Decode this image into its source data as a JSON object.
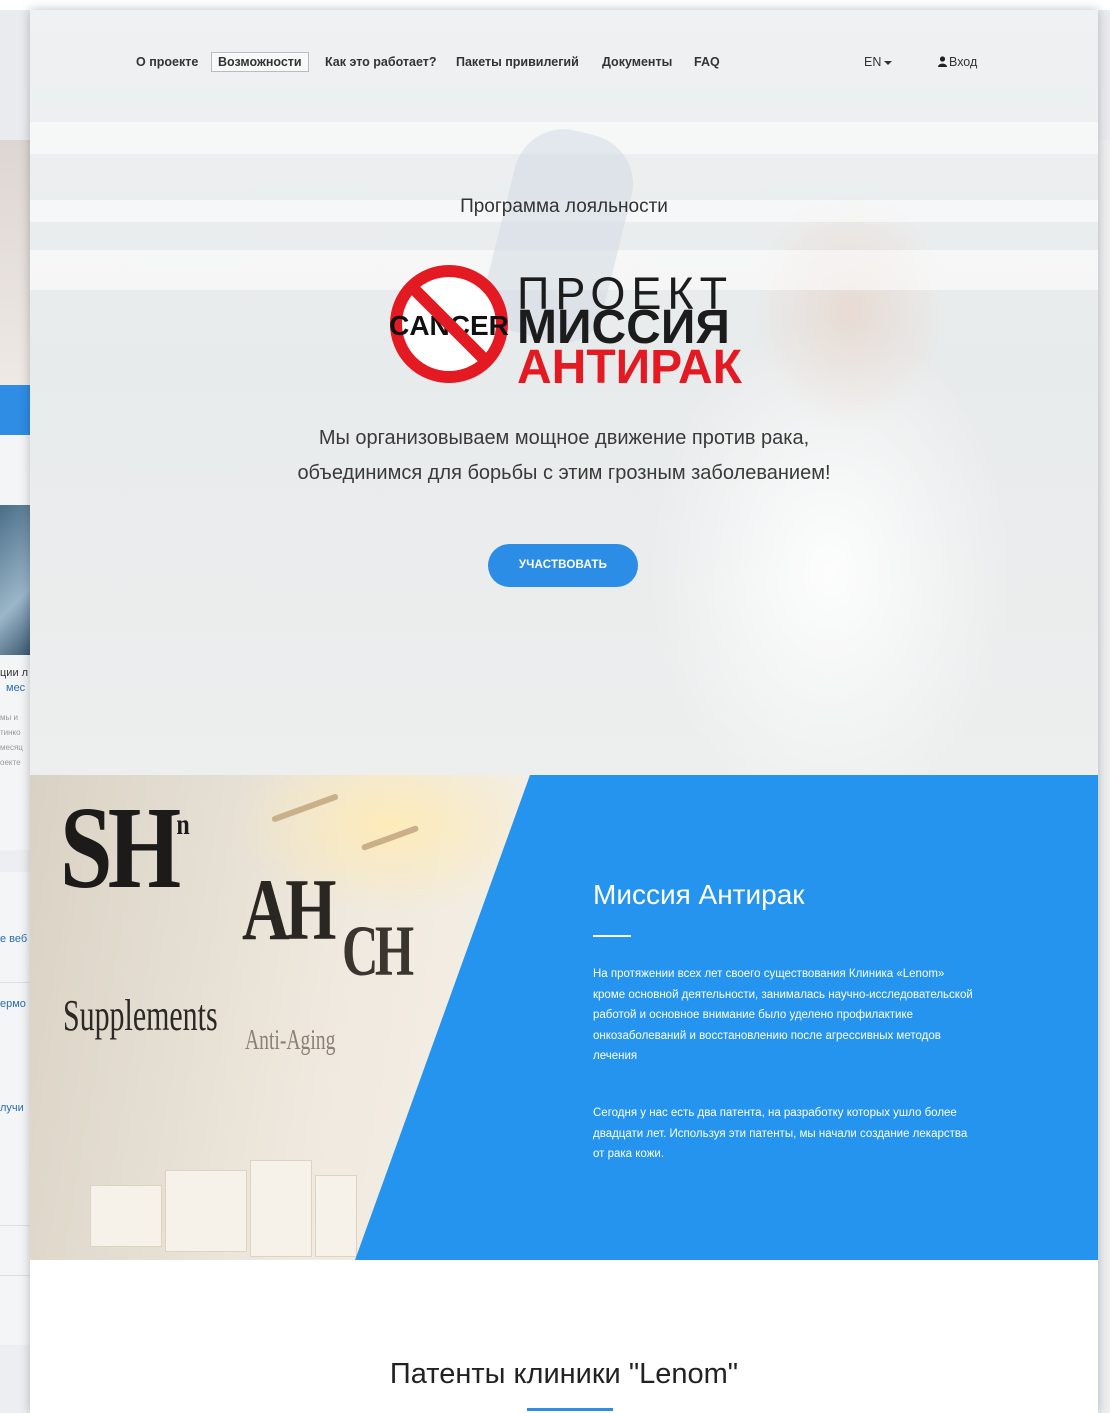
{
  "nav": {
    "items": [
      {
        "label": "О проекте",
        "active": false
      },
      {
        "label": "Возможности",
        "active": true
      },
      {
        "label": "Как это работает?",
        "active": false
      },
      {
        "label": "Пакеты привилегий",
        "active": false
      },
      {
        "label": "Документы",
        "active": false
      },
      {
        "label": "FAQ",
        "active": false
      }
    ],
    "language": "EN",
    "login": "Вход"
  },
  "hero": {
    "subtitle": "Программа лояльности",
    "logo": {
      "badge_text": "CANCER",
      "line1": "ПРОЕКТ",
      "line2": "МИССИЯ",
      "line3": "АНТИРАК"
    },
    "text_line1": "Мы организовываем мощное движение против рака,",
    "text_line2": "объединимся для борьбы с этим грозным заболеванием!",
    "cta": "УЧАСТВОВАТЬ"
  },
  "mission": {
    "photo_labels": [
      "SH",
      "AH",
      "CH",
      "Supplements",
      "Anti-Aging"
    ],
    "title": "Миссия Антирак",
    "paragraph1": "На протяжении всех лет своего существования Клиника «Lenom» кроме основной деятельности, занималась научно-исследовательской работой и основное внимание было уделено профилактике онкозаболеваний и восстановлению после агрессивных методов лечения",
    "paragraph2": "Сегодня у нас есть два патента, на разработку которых ушло более двадцати лет. Используя эти патенты, мы начали создание лекарства от рака кожи."
  },
  "patents": {
    "title": "Патенты клиники \"Lenom\""
  },
  "background_page": {
    "fragments": [
      "ции л",
      "мес",
      "е веб",
      "ермо",
      "лучи"
    ]
  },
  "colors": {
    "accent": "#2b8de5",
    "mission_blue": "#2594ef",
    "logo_red": "#e41a22"
  }
}
